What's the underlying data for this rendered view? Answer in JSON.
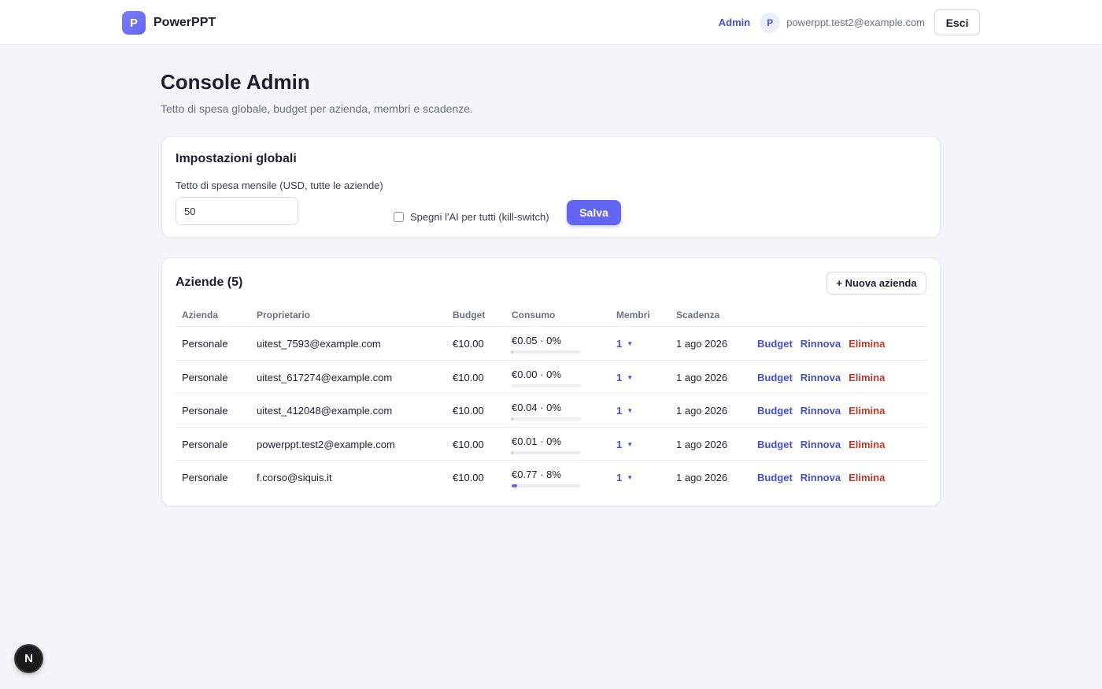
{
  "header": {
    "logo_letter": "P",
    "app_name": "PowerPPT",
    "admin_link": "Admin",
    "avatar_letter": "P",
    "user_email": "powerppt.test2@example.com",
    "logout_label": "Esci"
  },
  "page": {
    "title": "Console Admin",
    "subtitle": "Tetto di spesa globale, budget per azienda, membri e scadenze."
  },
  "global_settings": {
    "title": "Impostazioni globali",
    "cap_label": "Tetto di spesa mensile (USD, tutte le aziende)",
    "cap_value": "50",
    "kill_switch_label": "Spegni l'AI per tutti (kill-switch)",
    "kill_switch_checked": false,
    "save_label": "Salva"
  },
  "companies": {
    "title": "Aziende (5)",
    "new_label": "+ Nuova azienda",
    "columns": [
      "Azienda",
      "Proprietario",
      "Budget",
      "Consumo",
      "Membri",
      "Scadenza"
    ],
    "rows": [
      {
        "azienda": "Personale",
        "owner": "uitest_7593@example.com",
        "budget": "€10.00",
        "consumo": "€0.05 · 0%",
        "consumo_fraction": 0.005,
        "membri": "1",
        "scadenza": "1 ago 2026",
        "act_budget": "Budget",
        "act_renew": "Rinnova",
        "act_delete": "Elimina"
      },
      {
        "azienda": "Personale",
        "owner": "uitest_617274@example.com",
        "budget": "€10.00",
        "consumo": "€0.00 · 0%",
        "consumo_fraction": 0.0,
        "membri": "1",
        "scadenza": "1 ago 2026",
        "act_budget": "Budget",
        "act_renew": "Rinnova",
        "act_delete": "Elimina"
      },
      {
        "azienda": "Personale",
        "owner": "uitest_412048@example.com",
        "budget": "€10.00",
        "consumo": "€0.04 · 0%",
        "consumo_fraction": 0.004,
        "membri": "1",
        "scadenza": "1 ago 2026",
        "act_budget": "Budget",
        "act_renew": "Rinnova",
        "act_delete": "Elimina"
      },
      {
        "azienda": "Personale",
        "owner": "powerppt.test2@example.com",
        "budget": "€10.00",
        "consumo": "€0.01 · 0%",
        "consumo_fraction": 0.001,
        "membri": "1",
        "scadenza": "1 ago 2026",
        "act_budget": "Budget",
        "act_renew": "Rinnova",
        "act_delete": "Elimina"
      },
      {
        "azienda": "Personale",
        "owner": "f.corso@siquis.it",
        "budget": "€10.00",
        "consumo": "€0.77 · 8%",
        "consumo_fraction": 0.08,
        "membri": "1",
        "scadenza": "1 ago 2026",
        "act_budget": "Budget",
        "act_renew": "Rinnova",
        "act_delete": "Elimina"
      }
    ]
  },
  "dev_badge": {
    "letter": "N"
  },
  "colors": {
    "accent": "#6366f1",
    "link": "#4550c9",
    "danger": "#c0392b",
    "background": "#f4f5f9"
  }
}
